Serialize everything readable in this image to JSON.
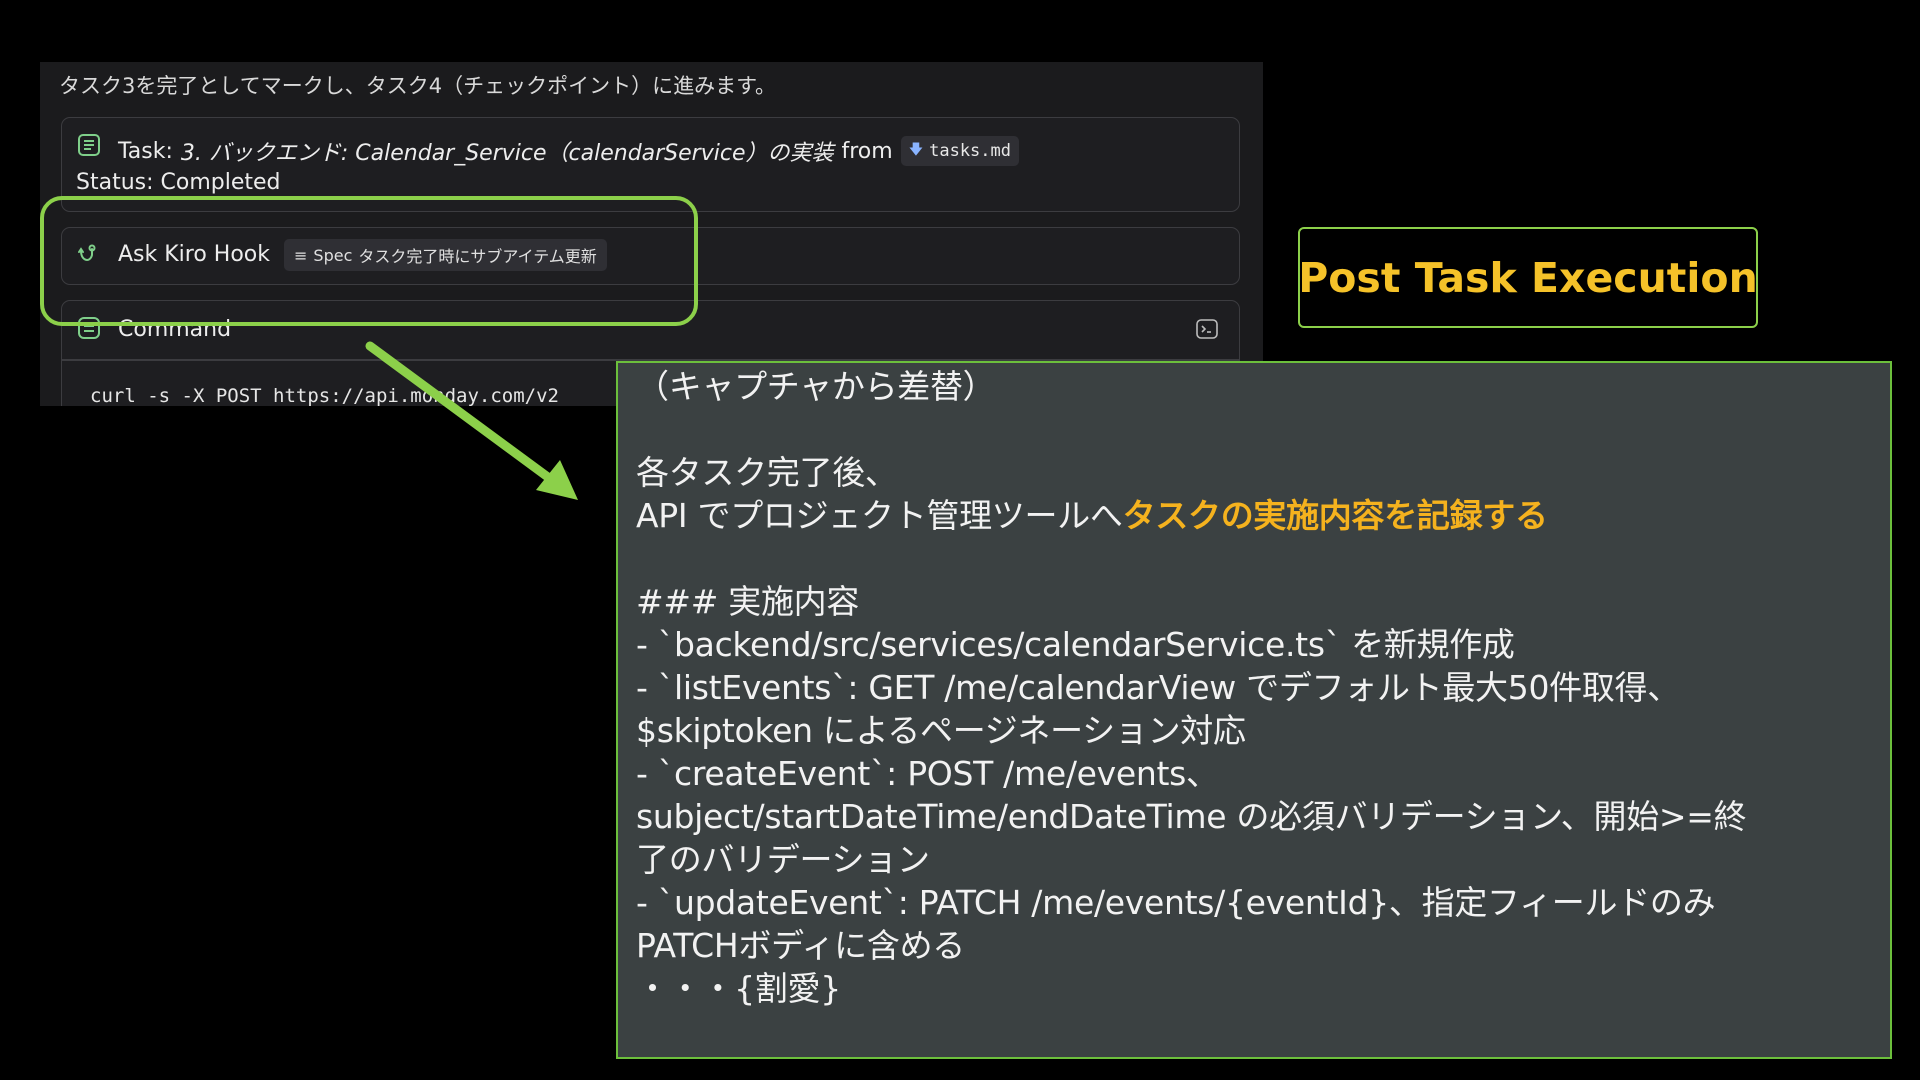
{
  "chat": {
    "intro": "タスク3を完了としてマークし、タスク4（チェックポイント）に進みます。",
    "task_card": {
      "prefix": "Task:",
      "title": "3. バックエンド: Calendar_Service（calendarService）の実装",
      "from_label": "from",
      "file": "tasks.md",
      "status": "Status: Completed"
    },
    "hook_card": {
      "label": "Ask Kiro Hook",
      "chip_prefix": "Spec",
      "chip_text": "タスク完了時にサブアイテム更新"
    },
    "command_card": {
      "label": "Command",
      "command": "curl -s -X POST https://api.monday.com/v2"
    }
  },
  "label_box": {
    "text": "Post Task Execution"
  },
  "info": {
    "line1": "（キャプチャから差替）",
    "line2": "各タスク完了後、",
    "line3_plain": "API でプロジェクト管理ツールへ",
    "line3_highlight": "タスクの実施内容を記録する",
    "line4": "### 実施内容",
    "line5": "- `backend/src/services/calendarService.ts` を新規作成",
    "line6": "- `listEvents`: GET /me/calendarView でデフォルト最大50件取得、",
    "line7": "$skiptoken によるページネーション対応",
    "line8": "- `createEvent`: POST /me/events、",
    "line9": "subject/startDateTime/endDateTime の必須バリデーション、開始>=終",
    "line10": "了のバリデーション",
    "line11": "- `updateEvent`: PATCH /me/events/{eventId}、指定フィールドのみ",
    "line12": "PATCHボディに含める",
    "line13": "・・・{割愛}"
  },
  "colors": {
    "accent_green": "#8cd04a",
    "highlight_yellow": "#f5b21e",
    "panel_bg": "#3b4142",
    "chat_bg": "#1b1b1d"
  },
  "icons": [
    "task-list-icon",
    "file-pin-icon",
    "hook-icon",
    "spec-list-icon",
    "command-icon",
    "terminal-icon",
    "arrow-icon"
  ]
}
